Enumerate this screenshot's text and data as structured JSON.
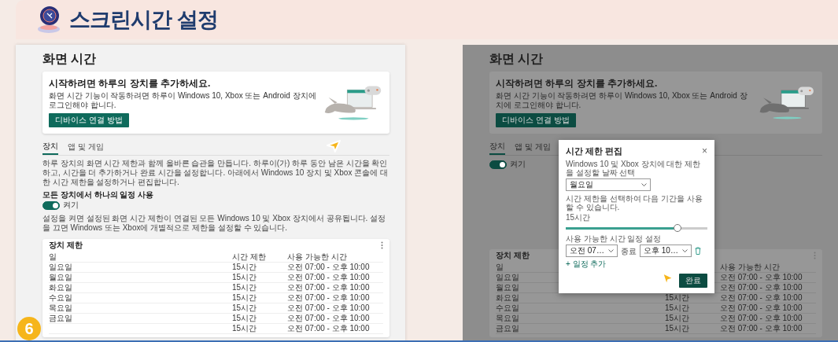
{
  "header": {
    "title": "스크린시간 설정"
  },
  "panels": [
    {
      "dimmed": false,
      "page_title": "화면 시간",
      "banner": {
        "heading": "시작하려면 하루의 장치를 추가하세요.",
        "text": "화면 시간 기능이 작동하려면 하루이 Windows 10, Xbox 또는 Android 장치에 로그인해야 합니다.",
        "button": "디바이스 연결 방법"
      },
      "tabs": [
        {
          "label": "장치",
          "selected": true
        },
        {
          "label": "앱 및 게임",
          "selected": false
        }
      ],
      "description": "하루 장치의 화면 시간 제한과 함께 올바른 습관을 만듭니다. 하루이(가) 하루 동안 남은 시간을 확인하고, 시간을 더 추가하거나 완료 시간을 설정합니다. 아래에서 Windows 10 장치 및 Xbox 콘솔에 대한 시간 제한을 설정하거나 편집합니다.",
      "schedule": {
        "label": "모든 장치에서 하나의 일정 사용",
        "on": true,
        "state_text": "켜기",
        "note": "설정을 켜면 설정된 화면 시간 제한이 연결된 모든 Windows 10 및 Xbox 장치에서 공유됩니다. 설정을 끄면 Windows 또는 Xbox에 개별적으로 제한을 설정할 수 있습니다."
      },
      "table": {
        "title": "장치 제한",
        "columns": {
          "day": "일",
          "limit": "시간 제한",
          "hours": "사용 가능한 시간"
        },
        "rows": [
          {
            "day": "일요일",
            "limit": "15시간",
            "hours": "오전 07:00 - 오후 10:00"
          },
          {
            "day": "월요일",
            "limit": "15시간",
            "hours": "오전 07:00 - 오후 10:00"
          },
          {
            "day": "화요일",
            "limit": "15시간",
            "hours": "오전 07:00 - 오후 10:00"
          },
          {
            "day": "수요일",
            "limit": "15시간",
            "hours": "오전 07:00 - 오후 10:00"
          },
          {
            "day": "목요일",
            "limit": "15시간",
            "hours": "오전 07:00 - 오후 10:00"
          },
          {
            "day": "금요일",
            "limit": "15시간",
            "hours": "오전 07:00 - 오후 10:00"
          },
          {
            "limit": "15시간",
            "hours": "오전 07:00 - 오후 10:00"
          }
        ]
      }
    },
    {
      "dimmed": true,
      "page_title": "화면 시간",
      "banner": {
        "heading": "시작하려면 하루의 장치를 추가하세요.",
        "text": "화면 시간 기능이 작동하려면 하루이 Windows 10, Xbox 또는 Android 장치에 로그인해야 합니다.",
        "button": "디바이스 연결 방법"
      },
      "tabs": [
        {
          "label": "장치",
          "selected": true
        },
        {
          "label": "앱 및 게임",
          "selected": false
        }
      ],
      "schedule": {
        "on": true,
        "state_text": "켜기"
      },
      "table": {
        "title": "장치 제한",
        "columns": {
          "day": "일",
          "hours": "사용 가능한 시간"
        },
        "rows": [
          {
            "day": "일요일",
            "hours": "오전 07:00 - 오후 10:00"
          },
          {
            "day": "월요일",
            "hours": "오전 07:00 - 오후 10:00"
          },
          {
            "day": "화요일",
            "limit": "15시간",
            "hours": "오전 07:00 - 오후 10:00"
          },
          {
            "day": "수요일",
            "limit": "15시간",
            "hours": "오전 07:00 - 오후 10:00"
          },
          {
            "day": "목요일",
            "limit": "15시간",
            "hours": "오전 07:00 - 오후 10:00"
          },
          {
            "day": "금요일",
            "limit": "15시간",
            "hours": "오전 07:00 - 오후 10:00"
          }
        ]
      },
      "dialog": {
        "title": "시간 제한 편집",
        "close": "×",
        "day_label": "Windows 10 및 Xbox 장치에 대한 제한을 설정할 날짜 선택",
        "day_value": "월요일",
        "limit_label": "시간 제한을 선택하여 다음 기간을 사용할 수 있습니다.",
        "limit_value": "15시간",
        "slider": {
          "level": 0.79
        },
        "schedule_label": "사용 가능한 시간 일정 설정",
        "start_value": "오전 07…",
        "between": "종료",
        "end_value": "오후 10…",
        "add": "+ 일정 추가",
        "done": "완료"
      }
    }
  ],
  "step_badge": "6"
}
